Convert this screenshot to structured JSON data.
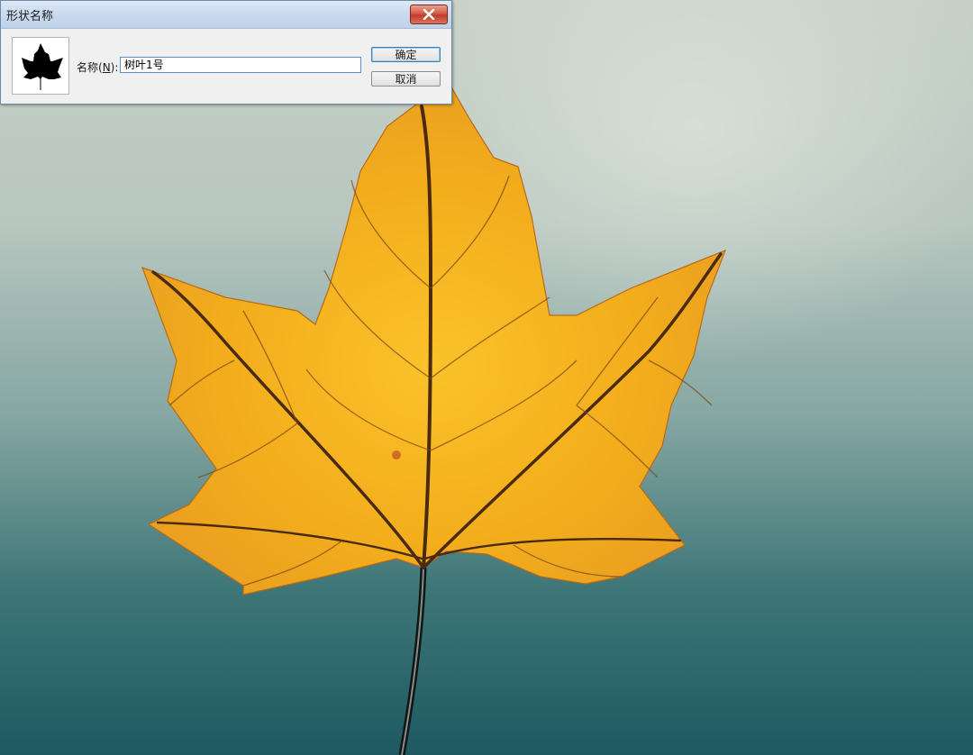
{
  "dialog": {
    "title": "形状名称",
    "name_label_prefix": "名称(",
    "name_label_key": "N",
    "name_label_suffix": "):",
    "name_value": "树叶1号",
    "ok_label": "确定",
    "cancel_label": "取消",
    "icons": {
      "close": "close-icon",
      "preview": "leaf-shape-preview"
    }
  },
  "colors": {
    "leaf_fill": "#f3b020",
    "leaf_vein": "#6a3a12",
    "close_button": "#c8432f",
    "focus_border": "#5b8fc9"
  }
}
